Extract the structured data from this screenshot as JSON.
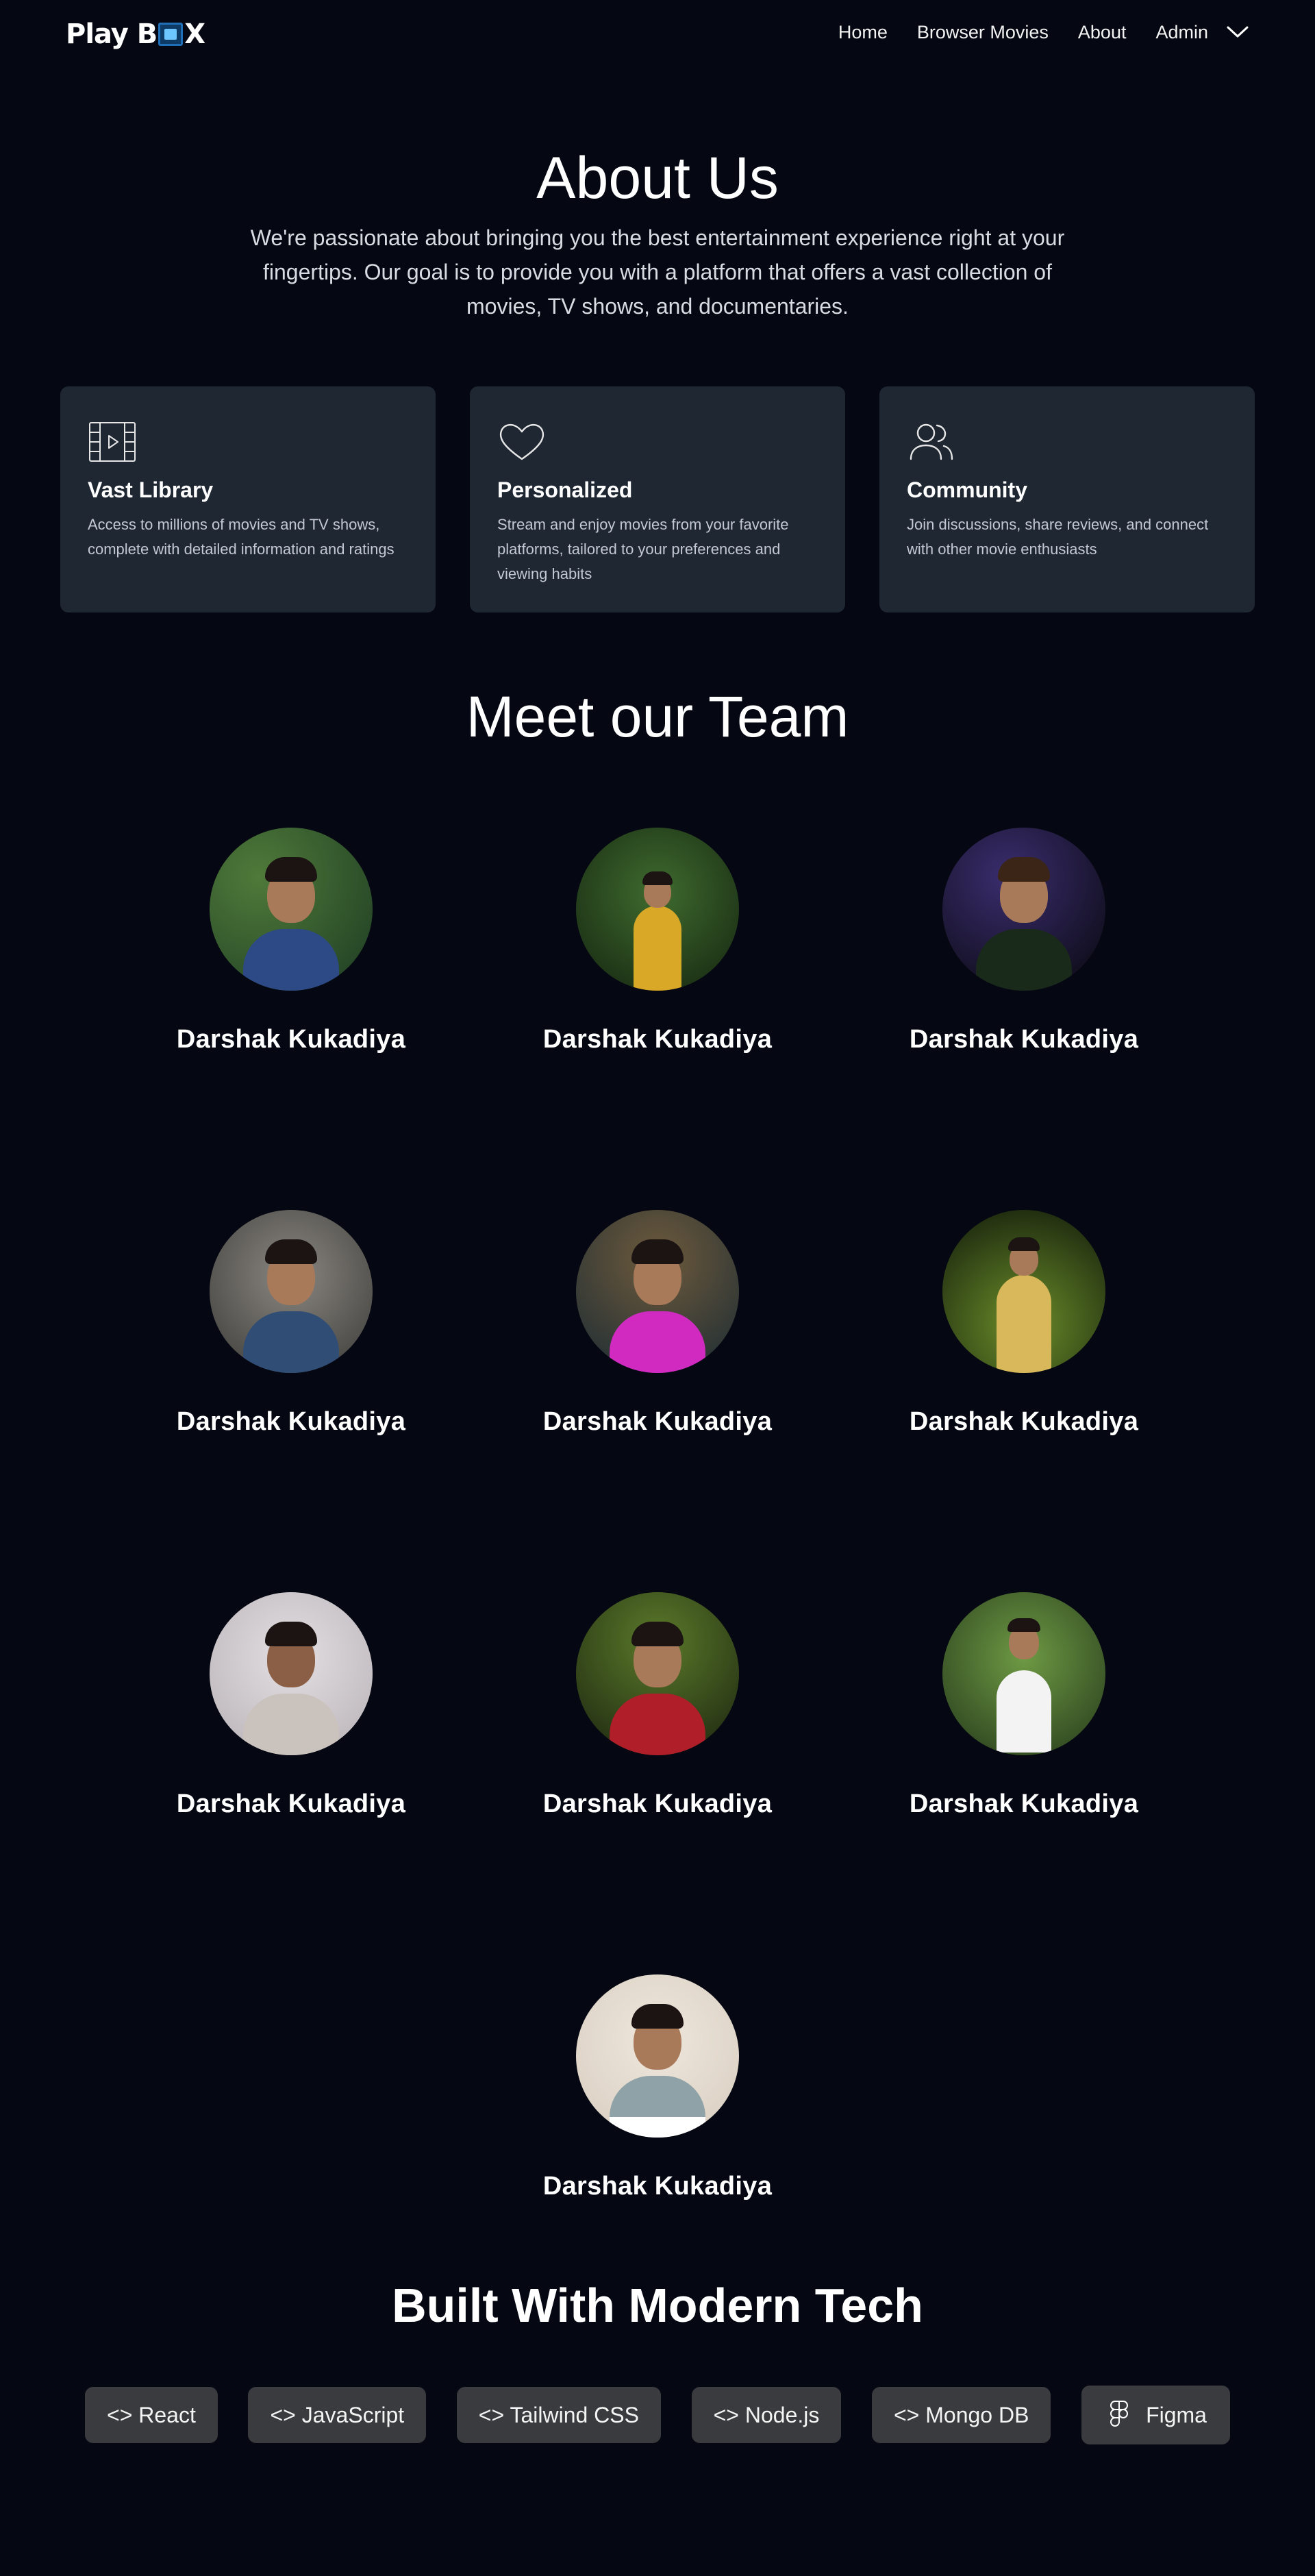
{
  "nav": {
    "logo_text_1": "Play B",
    "logo_text_2": "X",
    "links": [
      "Home",
      "Browser Movies",
      "About",
      "Admin"
    ]
  },
  "hero": {
    "title": "About Us",
    "text": "We're passionate about bringing you the best entertainment experience right at your fingertips. Our goal is to provide you with a platform that offers a vast collection of movies, TV shows, and documentaries."
  },
  "features": [
    {
      "icon": "film-icon",
      "title": "Vast Library",
      "text": "Access to millions of movies and TV shows, complete with detailed information and ratings"
    },
    {
      "icon": "heart-icon",
      "title": "Personalized",
      "text": "Stream and enjoy movies from your favorite platforms, tailored to your preferences and viewing habits"
    },
    {
      "icon": "users-icon",
      "title": "Community",
      "text": "Join discussions, share reviews, and connect with other movie enthusiasts"
    }
  ],
  "team": {
    "title": "Meet our Team",
    "members": [
      {
        "name": "Darshak Kukadiya"
      },
      {
        "name": "Darshak Kukadiya"
      },
      {
        "name": "Darshak Kukadiya"
      },
      {
        "name": "Darshak Kukadiya"
      },
      {
        "name": "Darshak Kukadiya"
      },
      {
        "name": "Darshak Kukadiya"
      },
      {
        "name": "Darshak Kukadiya"
      },
      {
        "name": "Darshak Kukadiya"
      },
      {
        "name": "Darshak Kukadiya"
      },
      {
        "name": "Darshak Kukadiya"
      }
    ]
  },
  "tech": {
    "title": "Built With Modern Tech",
    "chips": [
      "<> React",
      "<> JavaScript",
      "<> Tailwind CSS",
      "<> Node.js",
      "<> Mongo DB",
      "Figma"
    ]
  },
  "colors": {
    "background": "#050812",
    "card": "#1f2733",
    "chip": "#3a3b3e"
  }
}
